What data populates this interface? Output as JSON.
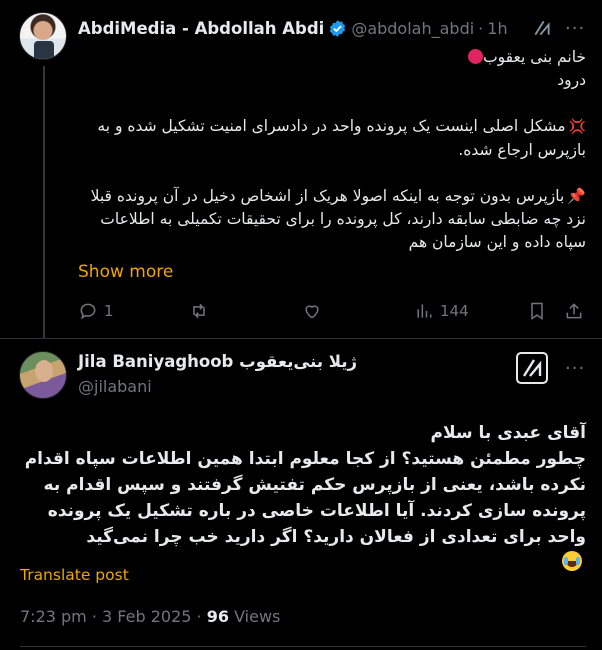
{
  "reply_tweet": {
    "display_name": "AbdiMedia - Abdollah Abdi",
    "handle": "@abdolah_abdi",
    "separator": "·",
    "time": "1h",
    "line1": "خانم بنی یعقوب",
    "line2": "درود",
    "para1": "مشکل اصلی اینست یک پرونده واحد در دادسرای امنیت تشکیل شده و به بازپرس ارجاع شده.",
    "para2": "بازپرس بدون توجه به اینکه اصولا هریک از اشخاص دخیل در آن پرونده قبلا نزد چه ضابطی سابقه دارند، کل پرونده را برای تحقیقات تکمیلی به اطلاعات سپاه داده و این سازمان هم",
    "show_more": "Show more",
    "replies": "1",
    "retweets": "",
    "likes": "",
    "views": "144"
  },
  "main_tweet": {
    "display_name": "Jila Baniyaghoob ژیلا بنی‌یعقوب",
    "handle": "@jilabani",
    "line1": "آقای عبدی با سلام",
    "body": "چطور مطمئن هستید؟ از کجا معلوم ابتدا همین اطلاعات سپاه اقدام نکرده باشد، یعنی از بازپرس حکم تفتیش گرفتند و سپس اقدام به پرونده سازی کردند. آیا اطلاعات خاصی در باره تشکیل یک پرونده واحد برای تعدادی از فعالان دارید؟ اگر دارید خب چرا نمی‌گید",
    "translate": "Translate post",
    "time": "7:23 pm",
    "date": "3 Feb 2025",
    "views_count": "96",
    "views_label": "Views"
  },
  "icons": {
    "reply": "reply-icon",
    "retweet": "retweet-icon",
    "like": "heart-icon",
    "views": "views-icon",
    "bookmark": "bookmark-icon",
    "share": "share-icon",
    "grok": "grok-icon",
    "more": "more-icon",
    "verified": "verified-badge-icon"
  },
  "colors": {
    "background": "#000000",
    "text": "#e7e9ea",
    "muted": "#71767b",
    "accent": "#f0a500",
    "verified": "#1d9bf0"
  }
}
